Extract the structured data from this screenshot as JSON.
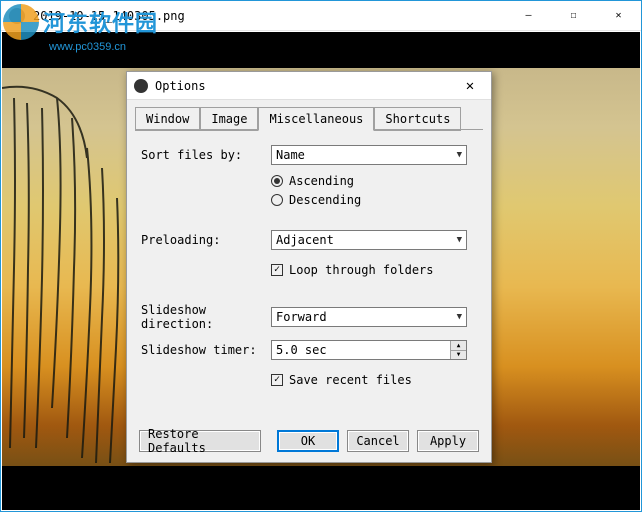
{
  "window": {
    "title": "2019-10-15_140305.png",
    "controls": {
      "min": "—",
      "max": "☐",
      "close": "✕"
    }
  },
  "watermark": {
    "text": "河东软件园",
    "url": "www.pc0359.cn"
  },
  "dialog": {
    "title": "Options",
    "close": "✕",
    "tabs": [
      "Window",
      "Image",
      "Miscellaneous",
      "Shortcuts"
    ],
    "active_tab": 2,
    "sort_label": "Sort files by:",
    "sort_value": "Name",
    "ascending": "Ascending",
    "descending": "Descending",
    "preloading_label": "Preloading:",
    "preloading_value": "Adjacent",
    "loop": "Loop through folders",
    "slideshow_dir_label": "Slideshow direction:",
    "slideshow_dir_value": "Forward",
    "slideshow_timer_label": "Slideshow timer:",
    "slideshow_timer_value": "5.0 sec",
    "save_recent": "Save recent files",
    "restore": "Restore Defaults",
    "ok": "OK",
    "cancel": "Cancel",
    "apply": "Apply"
  }
}
